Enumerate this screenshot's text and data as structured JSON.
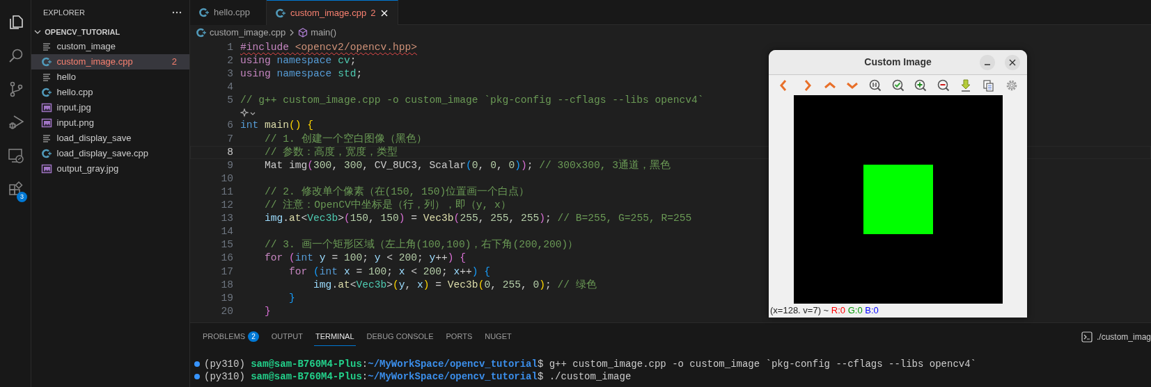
{
  "activity_bar": {
    "items": [
      {
        "kind": "files",
        "selected": true
      },
      {
        "kind": "search",
        "selected": false
      },
      {
        "kind": "source-control",
        "selected": false
      },
      {
        "kind": "run-debug",
        "selected": false
      },
      {
        "kind": "remote",
        "selected": false
      },
      {
        "kind": "extensions",
        "selected": false,
        "badge": "3"
      }
    ]
  },
  "explorer": {
    "title": "EXPLORER",
    "folder": {
      "name": "OPENCV_TUTORIAL",
      "expanded": true,
      "files": [
        {
          "name": "custom_image",
          "kind": "binary",
          "selected": false,
          "error": false
        },
        {
          "name": "custom_image.cpp",
          "kind": "cpp",
          "selected": true,
          "error": true,
          "badge": "2"
        },
        {
          "name": "hello",
          "kind": "binary",
          "selected": false,
          "error": false
        },
        {
          "name": "hello.cpp",
          "kind": "cpp",
          "selected": false,
          "error": false
        },
        {
          "name": "input.jpg",
          "kind": "image",
          "selected": false,
          "error": false
        },
        {
          "name": "input.png",
          "kind": "image",
          "selected": false,
          "error": false
        },
        {
          "name": "load_display_save",
          "kind": "binary",
          "selected": false,
          "error": false
        },
        {
          "name": "load_display_save.cpp",
          "kind": "cpp",
          "selected": false,
          "error": false
        },
        {
          "name": "output_gray.jpg",
          "kind": "image",
          "selected": false,
          "error": false
        }
      ]
    }
  },
  "editor": {
    "tabs": [
      {
        "name": "hello.cpp",
        "selected": false,
        "error": false
      },
      {
        "name": "custom_image.cpp",
        "selected": true,
        "error": true,
        "badge": "2"
      }
    ],
    "breadcrumb": [
      "custom_image.cpp",
      "main()"
    ],
    "lines": [
      {
        "kind": "code",
        "num": "1",
        "current": false,
        "error": true,
        "tokens": [
          {
            "kind": "kw",
            "text": "#include"
          },
          {
            "kind": "str",
            "text": " <opencv2/opencv.hpp>"
          }
        ]
      },
      {
        "kind": "code",
        "num": "2",
        "current": false,
        "error": false,
        "tokens": [
          {
            "kind": "kw",
            "text": "using "
          },
          {
            "kind": "kb",
            "text": "namespace "
          },
          {
            "kind": "ns",
            "text": "cv"
          },
          {
            "kind": "p",
            "text": ";"
          }
        ]
      },
      {
        "kind": "code",
        "num": "3",
        "current": false,
        "error": false,
        "tokens": [
          {
            "kind": "kw",
            "text": "using "
          },
          {
            "kind": "kb",
            "text": "namespace "
          },
          {
            "kind": "ns",
            "text": "std"
          },
          {
            "kind": "p",
            "text": ";"
          }
        ]
      },
      {
        "kind": "code",
        "num": "4",
        "current": false
      },
      {
        "kind": "code",
        "num": "5",
        "current": false,
        "error": false,
        "tokens": [
          {
            "kind": "cm",
            "text": "// g++ custom_image.cpp -o custom_image `pkg-config --cflags --libs opencv4`"
          }
        ]
      },
      {
        "kind": "lens"
      },
      {
        "kind": "code",
        "num": "6",
        "current": false,
        "error": false,
        "tokens": [
          {
            "kind": "kb",
            "text": "int "
          },
          {
            "kind": "fn",
            "text": "main"
          },
          {
            "kind": "b1",
            "text": "() {"
          }
        ]
      },
      {
        "kind": "code",
        "num": "7",
        "current": false,
        "error": false,
        "tokens": [
          {
            "kind": "cm",
            "text": "    // 1. 创建一个空白图像（黑色）"
          }
        ]
      },
      {
        "kind": "code",
        "num": "8",
        "current": true,
        "error": false,
        "tokens": [
          {
            "kind": "cm",
            "text": "    // 参数：高度，宽度，类型"
          }
        ]
      },
      {
        "kind": "code",
        "num": "9",
        "current": false,
        "error": false,
        "tokens": [
          {
            "kind": "p",
            "text": "    Mat img"
          },
          {
            "kind": "b2",
            "text": "("
          },
          {
            "kind": "num",
            "text": "300"
          },
          {
            "kind": "p",
            "text": ", "
          },
          {
            "kind": "num",
            "text": "300"
          },
          {
            "kind": "p",
            "text": ", CV_8UC3, Scalar"
          },
          {
            "kind": "b3",
            "text": "("
          },
          {
            "kind": "num",
            "text": "0"
          },
          {
            "kind": "p",
            "text": ", "
          },
          {
            "kind": "num",
            "text": "0"
          },
          {
            "kind": "p",
            "text": ", "
          },
          {
            "kind": "num",
            "text": "0"
          },
          {
            "kind": "b3",
            "text": ")"
          },
          {
            "kind": "b2",
            "text": ")"
          },
          {
            "kind": "p",
            "text": "; "
          },
          {
            "kind": "cm",
            "text": "// 300x300, 3通道，黑色"
          }
        ]
      },
      {
        "kind": "code",
        "num": "10",
        "current": false
      },
      {
        "kind": "code",
        "num": "11",
        "current": false,
        "error": false,
        "tokens": [
          {
            "kind": "cm",
            "text": "    // 2. 修改单个像素（在(150, 150)位置画一个白点）"
          }
        ]
      },
      {
        "kind": "code",
        "num": "12",
        "current": false,
        "error": false,
        "tokens": [
          {
            "kind": "cm",
            "text": "    // 注意：OpenCV中坐标是（行，列），即（y, x）"
          }
        ]
      },
      {
        "kind": "code",
        "num": "13",
        "current": false,
        "error": false,
        "tokens": [
          {
            "kind": "var",
            "text": "    img"
          },
          {
            "kind": "p",
            "text": "."
          },
          {
            "kind": "fn",
            "text": "at"
          },
          {
            "kind": "p",
            "text": "<"
          },
          {
            "kind": "ty",
            "text": "Vec3b"
          },
          {
            "kind": "p",
            "text": ">"
          },
          {
            "kind": "b2",
            "text": "("
          },
          {
            "kind": "num",
            "text": "150"
          },
          {
            "kind": "p",
            "text": ", "
          },
          {
            "kind": "num",
            "text": "150"
          },
          {
            "kind": "b2",
            "text": ")"
          },
          {
            "kind": "p",
            "text": " = "
          },
          {
            "kind": "fn",
            "text": "Vec3b"
          },
          {
            "kind": "b2",
            "text": "("
          },
          {
            "kind": "num",
            "text": "255"
          },
          {
            "kind": "p",
            "text": ", "
          },
          {
            "kind": "num",
            "text": "255"
          },
          {
            "kind": "p",
            "text": ", "
          },
          {
            "kind": "num",
            "text": "255"
          },
          {
            "kind": "b2",
            "text": ")"
          },
          {
            "kind": "p",
            "text": "; "
          },
          {
            "kind": "cm",
            "text": "// B=255, G=255, R=255"
          }
        ]
      },
      {
        "kind": "code",
        "num": "14",
        "current": false
      },
      {
        "kind": "code",
        "num": "15",
        "current": false,
        "error": false,
        "tokens": [
          {
            "kind": "cm",
            "text": "    // 3. 画一个矩形区域（左上角(100,100)，右下角(200,200)）"
          }
        ]
      },
      {
        "kind": "code",
        "num": "16",
        "current": false,
        "error": false,
        "tokens": [
          {
            "kind": "kw",
            "text": "    for "
          },
          {
            "kind": "b2",
            "text": "("
          },
          {
            "kind": "kb",
            "text": "int "
          },
          {
            "kind": "var",
            "text": "y"
          },
          {
            "kind": "p",
            "text": " = "
          },
          {
            "kind": "num",
            "text": "100"
          },
          {
            "kind": "p",
            "text": "; "
          },
          {
            "kind": "var",
            "text": "y"
          },
          {
            "kind": "p",
            "text": " < "
          },
          {
            "kind": "num",
            "text": "200"
          },
          {
            "kind": "p",
            "text": "; "
          },
          {
            "kind": "var",
            "text": "y"
          },
          {
            "kind": "p",
            "text": "++"
          },
          {
            "kind": "b2",
            "text": ") {"
          }
        ]
      },
      {
        "kind": "code",
        "num": "17",
        "current": false,
        "error": false,
        "tokens": [
          {
            "kind": "kw",
            "text": "        for "
          },
          {
            "kind": "b3",
            "text": "("
          },
          {
            "kind": "kb",
            "text": "int "
          },
          {
            "kind": "var",
            "text": "x"
          },
          {
            "kind": "p",
            "text": " = "
          },
          {
            "kind": "num",
            "text": "100"
          },
          {
            "kind": "p",
            "text": "; "
          },
          {
            "kind": "var",
            "text": "x"
          },
          {
            "kind": "p",
            "text": " < "
          },
          {
            "kind": "num",
            "text": "200"
          },
          {
            "kind": "p",
            "text": "; "
          },
          {
            "kind": "var",
            "text": "x"
          },
          {
            "kind": "p",
            "text": "++"
          },
          {
            "kind": "b3",
            "text": ") {"
          }
        ]
      },
      {
        "kind": "code",
        "num": "18",
        "current": false,
        "error": false,
        "tokens": [
          {
            "kind": "var",
            "text": "            img"
          },
          {
            "kind": "p",
            "text": "."
          },
          {
            "kind": "fn",
            "text": "at"
          },
          {
            "kind": "p",
            "text": "<"
          },
          {
            "kind": "ty",
            "text": "Vec3b"
          },
          {
            "kind": "p",
            "text": ">"
          },
          {
            "kind": "b1",
            "text": "("
          },
          {
            "kind": "var",
            "text": "y"
          },
          {
            "kind": "p",
            "text": ", "
          },
          {
            "kind": "var",
            "text": "x"
          },
          {
            "kind": "b1",
            "text": ")"
          },
          {
            "kind": "p",
            "text": " = "
          },
          {
            "kind": "fn",
            "text": "Vec3b"
          },
          {
            "kind": "b1",
            "text": "("
          },
          {
            "kind": "num",
            "text": "0"
          },
          {
            "kind": "p",
            "text": ", "
          },
          {
            "kind": "num",
            "text": "255"
          },
          {
            "kind": "p",
            "text": ", "
          },
          {
            "kind": "num",
            "text": "0"
          },
          {
            "kind": "b1",
            "text": ")"
          },
          {
            "kind": "p",
            "text": "; "
          },
          {
            "kind": "cm",
            "text": "// 绿色"
          }
        ]
      },
      {
        "kind": "code",
        "num": "19",
        "current": false,
        "error": false,
        "tokens": [
          {
            "kind": "b3",
            "text": "        }"
          }
        ]
      },
      {
        "kind": "code",
        "num": "20",
        "current": false,
        "error": false,
        "tokens": [
          {
            "kind": "b2",
            "text": "    }"
          }
        ]
      }
    ]
  },
  "panel": {
    "tabs": [
      {
        "label": "PROBLEMS",
        "selected": false,
        "badge": "2"
      },
      {
        "label": "OUTPUT",
        "selected": false
      },
      {
        "label": "TERMINAL",
        "selected": true
      },
      {
        "label": "DEBUG CONSOLE",
        "selected": false
      },
      {
        "label": "PORTS",
        "selected": false
      },
      {
        "label": "NUGET",
        "selected": false
      }
    ],
    "terminal_title": "./custom_imag",
    "terminal": [
      {
        "env": "(py310) ",
        "user": "sam@sam-B760M4-Plus",
        "sep": ":",
        "path": "~/MyWorkSpace/opencv_tutorial",
        "command": "$ g++ custom_image.cpp -o custom_image `pkg-config --cflags --libs opencv4`"
      },
      {
        "env": "(py310) ",
        "user": "sam@sam-B760M4-Plus",
        "sep": ":",
        "path": "~/MyWorkSpace/opencv_tutorial",
        "command": "$ ./custom_image"
      }
    ]
  },
  "image_window": {
    "title": "Custom Image",
    "tools": [
      {
        "kind": "prev"
      },
      {
        "kind": "next"
      },
      {
        "kind": "up"
      },
      {
        "kind": "down"
      },
      {
        "kind": "zoom-fit"
      },
      {
        "kind": "zoom-check"
      },
      {
        "kind": "zoom-in"
      },
      {
        "kind": "zoom-out"
      },
      {
        "kind": "save"
      },
      {
        "kind": "copy"
      },
      {
        "kind": "settings"
      }
    ],
    "status": {
      "text": "(x=128. v=7) ~",
      "channels": [
        {
          "text": "R:0",
          "color": "#ff0000"
        },
        {
          "text": "G:0",
          "color": "#009900"
        },
        {
          "text": "B:0",
          "color": "#0000ff"
        }
      ]
    }
  }
}
